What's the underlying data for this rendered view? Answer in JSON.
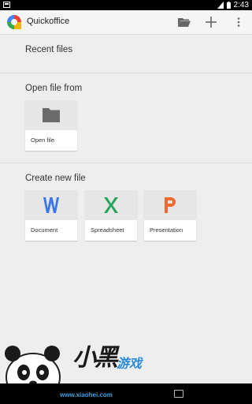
{
  "status_bar": {
    "time": "2:43"
  },
  "app_bar": {
    "title": "Quickoffice",
    "actions": [
      {
        "name": "open-folder",
        "icon": "folder-open-icon"
      },
      {
        "name": "new",
        "icon": "plus-icon"
      },
      {
        "name": "overflow",
        "icon": "overflow-menu-icon"
      }
    ]
  },
  "sections": {
    "recent": {
      "title": "Recent files"
    },
    "open": {
      "title": "Open file from",
      "items": [
        {
          "label": "Open file",
          "icon": "folder-icon"
        }
      ]
    },
    "create": {
      "title": "Create new file",
      "items": [
        {
          "label": "Document",
          "glyph": "W",
          "color": "#3b78e7"
        },
        {
          "label": "Spreadsheet",
          "glyph": "X",
          "color": "#26a65b"
        },
        {
          "label": "Presentation",
          "glyph": "P",
          "color": "#f06a30"
        }
      ]
    }
  },
  "watermark": {
    "brand": "小黑",
    "brand2": "游戏",
    "url": "www.xiaohei.com"
  }
}
